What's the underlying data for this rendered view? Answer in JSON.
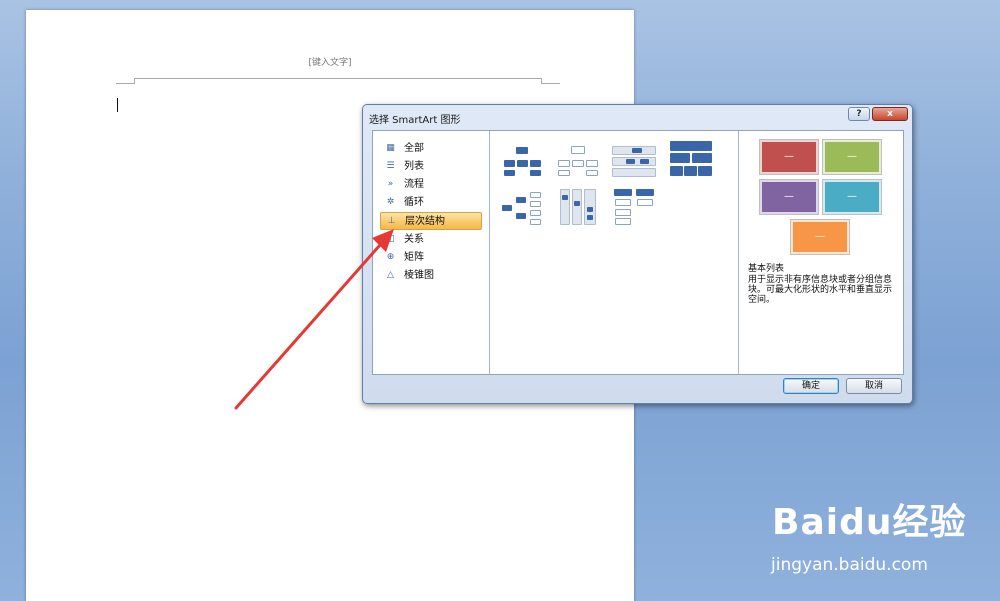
{
  "document": {
    "header_placeholder": "[键入文字]"
  },
  "dialog": {
    "title": "选择 SmartArt 图形",
    "help_label": "?",
    "close_label": "x",
    "categories": [
      {
        "label": "全部",
        "icon": "all-icon"
      },
      {
        "label": "列表",
        "icon": "list-icon"
      },
      {
        "label": "流程",
        "icon": "process-icon"
      },
      {
        "label": "循环",
        "icon": "cycle-icon"
      },
      {
        "label": "层次结构",
        "icon": "hierarchy-icon",
        "selected": true
      },
      {
        "label": "关系",
        "icon": "relationship-icon"
      },
      {
        "label": "矩阵",
        "icon": "matrix-icon"
      },
      {
        "label": "棱锥图",
        "icon": "pyramid-icon"
      }
    ],
    "preview": {
      "colors": [
        "#c0504d",
        "#9bbb59",
        "#8064a2",
        "#4bacc6",
        "#f79646"
      ],
      "box_label": "—",
      "title": "基本列表",
      "description": "用于显示非有序信息块或者分组信息块。可最大化形状的水平和垂直显示空间。"
    },
    "ok_label": "确定",
    "cancel_label": "取消"
  },
  "watermark": {
    "brand": "Bai",
    "brand_suffix": "du经验",
    "url": "jingyan.baidu.com"
  },
  "colors": {
    "selection": "#f9c86a",
    "smartart_dark": "#3a66a8",
    "arrow": "#e53935"
  }
}
